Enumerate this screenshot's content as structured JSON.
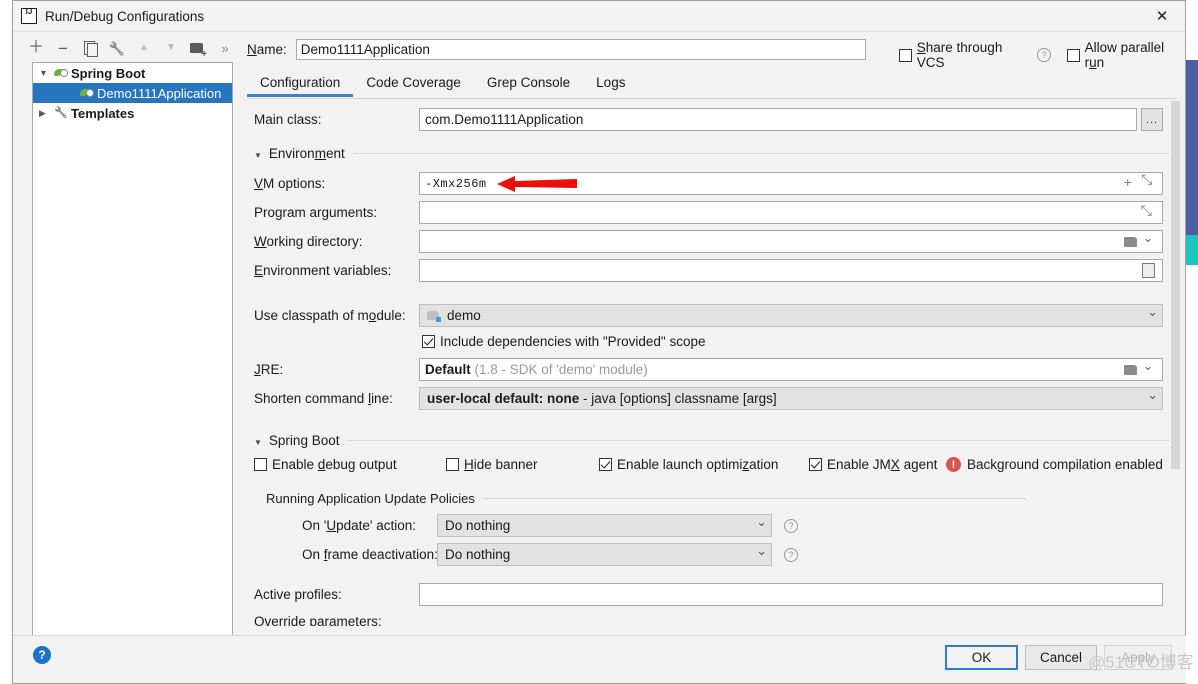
{
  "window": {
    "title": "Run/Debug Configurations",
    "app_icon": "intellij-logo-icon",
    "close_label": "✕"
  },
  "toolbar": {
    "items": [
      {
        "name": "add-configuration-button",
        "icon": "plus-icon",
        "label": "+"
      },
      {
        "name": "remove-configuration-button",
        "icon": "minus-icon",
        "label": "−"
      },
      {
        "name": "copy-configuration-button",
        "icon": "copy-icon",
        "label": ""
      },
      {
        "name": "edit-templates-button",
        "icon": "wrench-icon",
        "label": ""
      },
      {
        "name": "move-up-button",
        "icon": "arrow-up-icon",
        "label": "▲"
      },
      {
        "name": "move-down-button",
        "icon": "arrow-down-icon",
        "label": "▼"
      },
      {
        "name": "new-folder-button",
        "icon": "folder-plus-icon",
        "label": ""
      },
      {
        "name": "more-options-button",
        "icon": "chevrons-right-icon",
        "label": "»"
      }
    ]
  },
  "tree": {
    "nodes": [
      {
        "label": "Spring Boot",
        "twisty": "▼",
        "icon": "spring-boot-icon",
        "bold": true,
        "selected": false,
        "indent": 0
      },
      {
        "label": "Demo1111Application",
        "twisty": "",
        "icon": "spring-boot-icon",
        "bold": false,
        "selected": true,
        "indent": 1
      },
      {
        "label": "Templates",
        "twisty": "▶",
        "icon": "wrench-icon",
        "bold": true,
        "selected": false,
        "indent": 0
      }
    ]
  },
  "name_field": {
    "label": "Name:",
    "label_mnemonic": "N",
    "value": "Demo1111Application",
    "placeholder": ""
  },
  "header_options": {
    "share_vcs": {
      "label": "Share through VCS",
      "checked": false,
      "help": "?"
    },
    "allow_parallel": {
      "label": "Allow parallel run",
      "checked": false
    }
  },
  "tabs": [
    {
      "label": "Configuration",
      "active": true
    },
    {
      "label": "Code Coverage",
      "active": false
    },
    {
      "label": "Grep Console",
      "active": false
    },
    {
      "label": "Logs",
      "active": false
    }
  ],
  "form": {
    "main_class": {
      "label": "Main class:",
      "value": "com.Demo1111Application",
      "browse_button": "..."
    },
    "environment_section": {
      "label": "Environment",
      "expanded": true,
      "twisty": "▼"
    },
    "vm_options": {
      "label": "VM options:",
      "label_mnemonic": "V",
      "value": "-Xmx256m",
      "icons": [
        "plus-icon",
        "expand-icon"
      ]
    },
    "program_arguments": {
      "label": "Program arguments:",
      "value": "",
      "icons": [
        "expand-icon"
      ]
    },
    "working_directory": {
      "label": "Working directory:",
      "value": "",
      "icons": [
        "folder-icon",
        "chevron-down-icon"
      ]
    },
    "environment_variables": {
      "label": "Environment variables:",
      "value": "",
      "icons": [
        "document-icon"
      ]
    },
    "use_classpath": {
      "label": "Use classpath of module:",
      "value": "demo",
      "icon": "module-icon"
    },
    "include_provided": {
      "label": "Include dependencies with \"Provided\" scope",
      "checked": true
    },
    "jre": {
      "label": "JRE:",
      "label_mnemonic": "J",
      "value": "Default",
      "value_hint": "(1.8 - SDK of 'demo' module)",
      "icons": [
        "folder-icon",
        "chevron-down-icon"
      ]
    },
    "shorten_command_line": {
      "label": "Shorten command line:",
      "value": "user-local default: none",
      "value_hint": "- java [options] classname [args]"
    },
    "spring_boot_section": {
      "label": "Spring Boot",
      "expanded": true,
      "twisty": "▼"
    },
    "checkboxes": [
      {
        "label": "Enable debug output",
        "checked": false,
        "name": "enable-debug-output-checkbox"
      },
      {
        "label": "Hide banner",
        "checked": false,
        "name": "hide-banner-checkbox"
      },
      {
        "label": "Enable launch optimization",
        "checked": true,
        "name": "enable-launch-optimization-checkbox"
      },
      {
        "label": "Enable JMX agent",
        "checked": true,
        "name": "enable-jmx-agent-checkbox"
      }
    ],
    "background_compilation": {
      "label": "Background compilation enabled",
      "icon": "warning-icon",
      "icon_glyph": "!"
    },
    "update_policies_section": {
      "label": "Running Application Update Policies"
    },
    "on_update_action": {
      "label": "On 'Update' action:",
      "value": "Do nothing",
      "help": "?"
    },
    "on_frame_deactivation": {
      "label": "On frame deactivation:",
      "value": "Do nothing",
      "help": "?"
    },
    "active_profiles": {
      "label": "Active profiles:",
      "value": ""
    },
    "override_parameters": {
      "label": "Override parameters:"
    }
  },
  "annotation": {
    "type": "red-arrow",
    "color": "#e8100f",
    "points_at": "-Xmx256m"
  },
  "buttons": {
    "help": "?",
    "ok": "OK",
    "cancel": "Cancel",
    "apply": "Apply"
  },
  "watermark": "@51CTO博客",
  "colors": {
    "accent": "#3d7fc1",
    "selection": "#2675bf",
    "warning": "#d9534f",
    "dialog_bg": "#f2f2f2",
    "spring_green": "#6cb33f"
  }
}
